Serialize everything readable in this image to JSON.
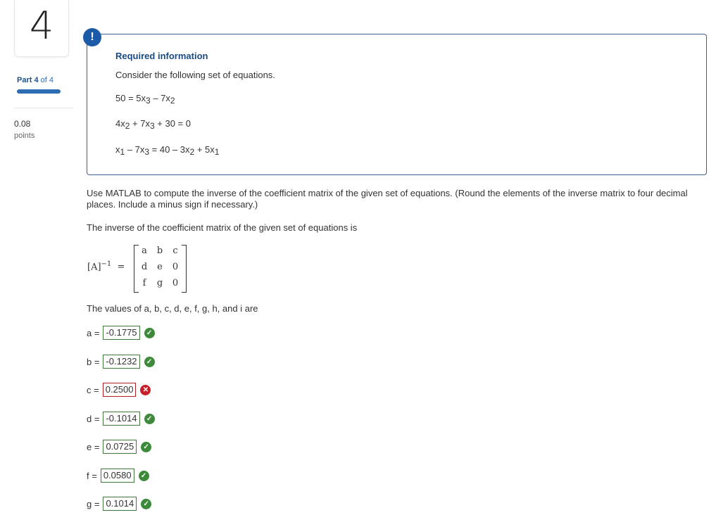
{
  "question": {
    "number": "4"
  },
  "part": {
    "label": "Part",
    "current": "4",
    "of_text": "of 4",
    "progress": 1.0
  },
  "points": {
    "value": "0.08",
    "label": "points"
  },
  "info": {
    "badge": "!",
    "title": "Required information",
    "intro": "Consider the following set of equations.",
    "equations": [
      {
        "parts": [
          "50 = 5x",
          "3",
          " – 7x",
          "2",
          ""
        ]
      },
      {
        "parts": [
          "4x",
          "2",
          " + 7x",
          "3",
          " + 30 = 0"
        ]
      },
      {
        "parts": [
          "x",
          "1",
          " – 7x",
          "3",
          " = 40 – 3x",
          "2",
          " + 5x",
          "1",
          ""
        ]
      }
    ]
  },
  "prompt": "Use MATLAB to compute the inverse of the coefficient matrix of the given set of equations. (Round the elements of the inverse matrix to four decimal places. Include a minus sign if necessary.)",
  "statement": "The inverse of the coefficient matrix of the given set of equations is",
  "matrix": {
    "label": "[A]",
    "sup": "−1",
    "eq": "=",
    "cells": [
      [
        "a",
        "b",
        "c"
      ],
      [
        "d",
        "e",
        "0"
      ],
      [
        "f",
        "g",
        "0"
      ]
    ]
  },
  "values_intro": "The values of a, b, c, d, e, f, g, h, and i are",
  "answers": [
    {
      "label": "a =",
      "value": "-0.1775",
      "status": "correct"
    },
    {
      "label": "b =",
      "value": "-0.1232",
      "status": "correct"
    },
    {
      "label": "c =",
      "value": "0.2500",
      "status": "incorrect"
    },
    {
      "label": "d =",
      "value": "-0.1014",
      "status": "correct"
    },
    {
      "label": "e =",
      "value": "0.0725",
      "status": "correct"
    },
    {
      "label": "f =",
      "value": "0.0580",
      "status": "correct"
    },
    {
      "label": "g =",
      "value": "0.1014",
      "status": "correct"
    }
  ],
  "status_icons": {
    "correct": "✓",
    "incorrect": "✕"
  },
  "colors": {
    "accent": "#1b5aa6",
    "correct": "#3c8a3a",
    "incorrect": "#c8202a"
  }
}
